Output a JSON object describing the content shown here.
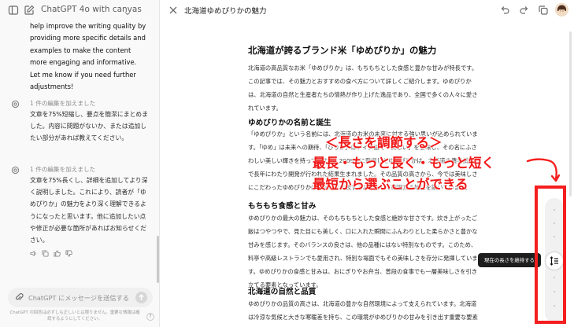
{
  "left": {
    "model_name": "ChatGPT 4o with canvas",
    "assistant_message": "help improve the writing quality by providing more specific details and examples to make the content more engaging and informative. Let me know if you need further adjustments!",
    "edits": [
      {
        "label": "1 件の編集を加えました",
        "text": "文章を75%短縮し、要点を簡潔にまとめました。内容に問題がないか、または追加したい部分があれば教えてください。"
      },
      {
        "label": "1 件の編集を加えました",
        "text": "文章を75%長くし、詳細を追加してより深く説明しました。これにより、読者が「ゆめぴりか」の魅力をより深く理解できるようになったと思います。他に追加したい点や修正が必要な箇所があればお知らせください。"
      }
    ],
    "composer_placeholder": "ChatGPT にメッセージを送信する",
    "disclaimer": "ChatGPT の回答は必ずしも正しいとは限りません。重要な情報は確認するようにしてください。",
    "help": "?"
  },
  "canvas": {
    "title": "北海道ゆめぴりかの魅力",
    "doc_title": "北海道が誇るブランド米「ゆめぴりか」の魅力",
    "paragraphs": [
      "北海道の高品質なお米「ゆめぴりか」は、もちもちとした食感と豊かな甘みが特長です。この記事では、その魅力とおすすめの食べ方について詳しくご紹介します。ゆめぴりかは、北海道の自然と生産者たちの情熱が作り上げた逸品であり、全国で多くの人々に愛されています。",
      "「ゆめぴりか」という名前には、北海道のお米の未来に対する強い思いが込められています。「ゆめ」は未来への期待、「ぴりか」はアイヌ語で「美しい」を意味し、その名にふさわしい美しい輝きを持っています。2009年に登場したゆめぴりかは、北海道の農業試験場で長年にわたり開発が行われた結果生まれました。その品質の高さから、今では美味しさにこだわったゆめぴりかは北海道を代表するお米として確固たる地位を築いています。",
      "ゆめぴりかの最大の魅力は、そのもちもちとした食感と絶妙な甘さです。炊き上がったご飯はつやつやで、見た目にも美しく、口に入れた瞬間にふんわりとした柔らかさと豊かな甘みを感じます。そのバランスの良さは、他の品種にはない特別なものです。このため、料亭や高級レストランでも愛用され、特別な場面でもその美味しさを存分に発揮しています。ゆめぴりかの食感と甘みは、おにぎりやお弁当、普段の食事でも一層美味しさを引き立てる要素となっています。",
      "ゆめぴりかの品質の高さは、北海道の豊かな自然環境によって支えられています。北海道は冷涼な気候と大きな寒暖差を持ち、この環境がゆめぴりかの甘みを引き出す重要な要素となっています。"
    ],
    "headings": [
      "ゆめぴりかの名前と誕生",
      "もちもち食感と甘み",
      "北海道の自然と品質"
    ],
    "tooltip": "現在の長さを維持する"
  },
  "annotation": {
    "line1": "＜長さを調節する＞",
    "line2": "最長・もっと長く・もっと短く",
    "line3": "最短から選ぶことができる",
    "color": "#f01818"
  },
  "icons": {
    "sidebar": "sidebar-icon",
    "new_chat": "edit-icon",
    "close": "close-icon",
    "undo": "undo-icon",
    "redo": "redo-icon",
    "copy": "copy-icon",
    "length": "length-adjust-icon"
  }
}
